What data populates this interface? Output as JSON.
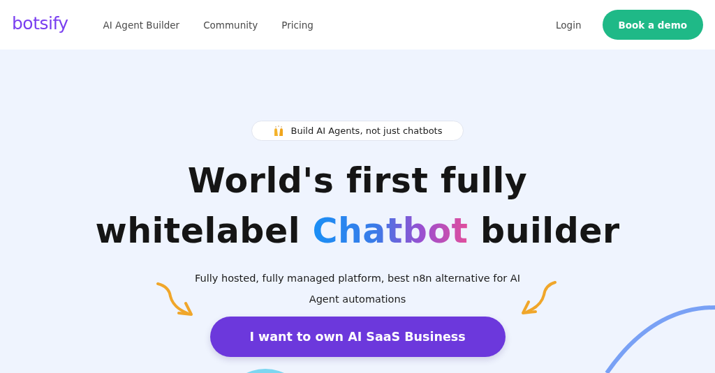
{
  "header": {
    "logo": "botsify",
    "nav": [
      {
        "label": "AI Agent Builder"
      },
      {
        "label": "Community"
      },
      {
        "label": "Pricing"
      }
    ],
    "login": "Login",
    "cta": "Book a demo"
  },
  "hero": {
    "badge": "Build AI Agents, not just chatbots",
    "headline": {
      "line_1": "World's first fully",
      "line_2_start": "whitelabel",
      "highlight": "Chatbot",
      "line_2_end": "builder"
    },
    "subtitle": "Fully hosted, fully managed platform, best n8n alternative for AI Agent automations",
    "button": "I want to own AI SaaS Business"
  }
}
